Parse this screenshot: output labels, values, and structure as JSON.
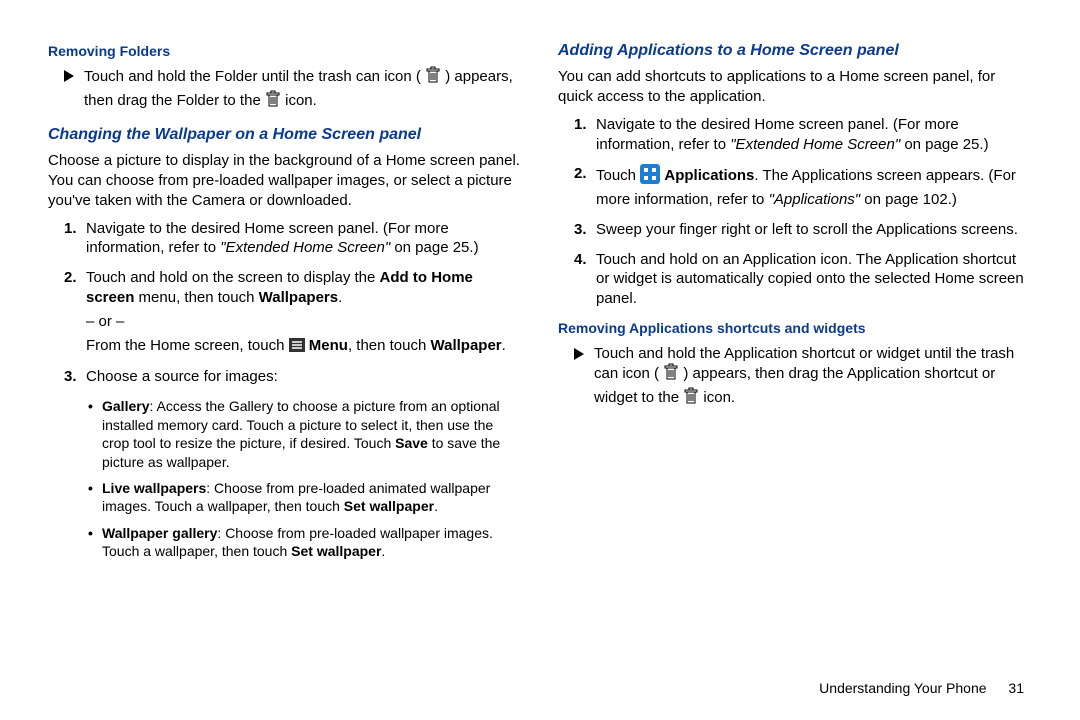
{
  "left": {
    "heading_removing_folders": "Removing Folders",
    "removing_folders_pre": "Touch and hold the Folder until the trash can icon (",
    "removing_folders_mid": ") appears, then drag the Folder to the ",
    "removing_folders_end": " icon.",
    "heading_wallpaper": "Changing the Wallpaper on a Home Screen panel",
    "wallpaper_intro": "Choose a picture to display in the background of a Home screen panel. You can choose from pre-loaded wallpaper images, or select a picture you've taken with the Camera or downloaded.",
    "step1_a": "Navigate to the desired Home screen panel. (For more information, refer to ",
    "step1_ref": "\"Extended Home Screen\"",
    "step1_b": " on page 25.)",
    "step2_a": "Touch and hold on the screen to display the ",
    "step2_b": "Add to Home screen",
    "step2_c": " menu, then touch ",
    "step2_d": "Wallpapers",
    "step2_e": ".",
    "step2_or": "– or –",
    "step2_f": "From the Home screen, touch ",
    "step2_menu": "Menu",
    "step2_g": ", then touch ",
    "step2_wp": "Wallpaper",
    "step2_h": ".",
    "step3": "Choose a source for images:",
    "bul1_label": "Gallery",
    "bul1_text": ": Access the Gallery to choose a picture from an optional installed memory card. Touch a picture to select it, then use the crop tool to resize the picture, if desired. Touch ",
    "bul1_save": "Save",
    "bul1_end": " to save the picture as wallpaper.",
    "bul2_label": "Live wallpapers",
    "bul2_text": ": Choose from pre-loaded animated wallpaper images. Touch a wallpaper, then touch ",
    "bul2_set": "Set wallpaper",
    "bul2_end": ".",
    "bul3_label": "Wallpaper gallery",
    "bul3_text": ": Choose from pre-loaded wallpaper images. Touch a wallpaper, then touch ",
    "bul3_set": "Set wallpaper",
    "bul3_end": "."
  },
  "right": {
    "heading_adding": "Adding Applications to a Home Screen panel",
    "adding_intro": "You can add shortcuts to applications to a Home screen panel, for quick access to the application.",
    "rstep1_a": "Navigate to the desired Home screen panel. (For more information, refer to ",
    "rstep1_ref": "\"Extended Home Screen\"",
    "rstep1_b": " on page 25.)",
    "rstep2_a": "Touch ",
    "rstep2_apps": "Applications",
    "rstep2_b": ". The Applications screen appears. (For more information, refer to ",
    "rstep2_ref": "\"Applications\"",
    "rstep2_c": " on page 102.)",
    "rstep3": "Sweep your finger right or left to scroll the Applications screens.",
    "rstep4": "Touch and hold on an Application icon. The Application shortcut or widget is automatically copied onto the selected Home screen panel.",
    "heading_removing_apps": "Removing Applications shortcuts and widgets",
    "rem_a": "Touch and hold the Application shortcut or widget until the trash can icon (",
    "rem_b": ") appears, then drag the Application shortcut or widget to the ",
    "rem_c": " icon."
  },
  "footer": {
    "section": "Understanding Your Phone",
    "page": "31"
  },
  "numbers": {
    "n1": "1.",
    "n2": "2.",
    "n3": "3.",
    "n4": "4."
  },
  "bullet": "•"
}
